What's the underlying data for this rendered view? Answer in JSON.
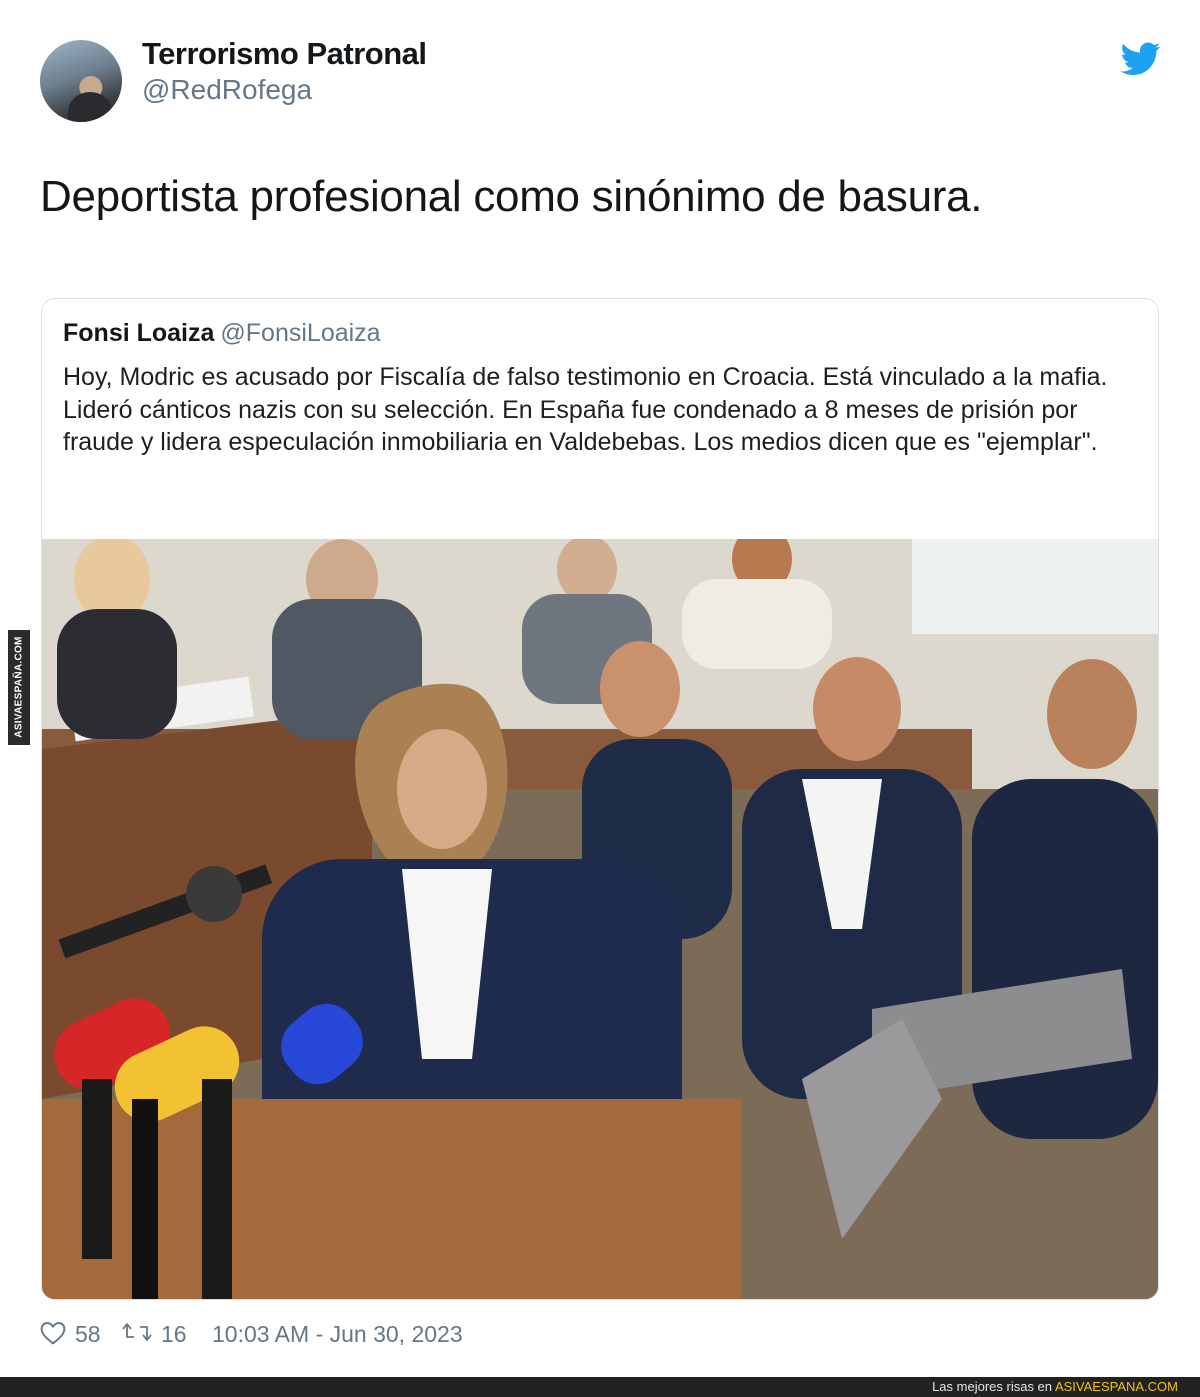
{
  "tweet": {
    "display_name": "Terrorismo Patronal",
    "handle": "@RedRofega",
    "text": "Deportista profesional como sinónimo de basura.",
    "likes": "58",
    "retweets": "16",
    "timestamp": "10:03 AM - Jun 30, 2023",
    "brand_icon": "twitter-bird-icon",
    "accent_color": "#1da1f2"
  },
  "quoted_tweet": {
    "display_name": "Fonsi Loaiza",
    "handle": "@FonsiLoaiza",
    "text": "Hoy, Modric es acusado por Fiscalía de falso testimonio en Croacia. Está vinculado a la mafia. Lideró cánticos nazis con su selección. En España fue condenado a 8 meses de prisión por fraude y lidera especulación inmobiliaria en Valdebebas. Los medios dicen que es \"ejemplar\"."
  },
  "watermark": {
    "prefix": "Las mejores risas en",
    "site": "ASIVAESPANA.COM",
    "side_label": "ASIVAESPAÑA.COM"
  }
}
